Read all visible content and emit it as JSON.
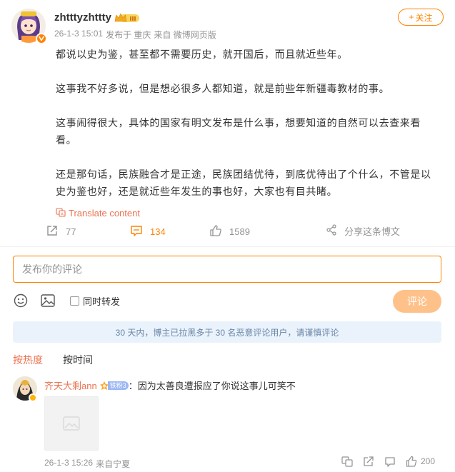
{
  "post": {
    "username": "zhtttyzhttty",
    "member_level": "III",
    "date": "26-1-3 15:01",
    "location": "发布于 重庆",
    "source": "来自 微博网页版",
    "follow_label": "关注",
    "paragraphs": [
      "都说以史为鉴，甚至都不需要历史，就开国后，而且就近些年。",
      "这事我不好多说，但是想必很多人都知道，就是前些年新疆毒教材的事。",
      "这事闹得很大，具体的国家有明文发布是什么事，想要知道的自然可以去查来看看。",
      "还是那句话，民族融合才是正途，民族团结优待，到底优待出了个什么，不管是以史为鉴也好，还是就近些年发生的事也好，大家也有目共睹。"
    ],
    "translate_label": "Translate content",
    "repost_count": "77",
    "comment_count": "134",
    "like_count": "1589",
    "share_label": "分享这条博文"
  },
  "composer": {
    "placeholder": "发布你的评论",
    "repost_label": "同时转发",
    "submit_label": "评论"
  },
  "notice": "30 天内，博主已拉黑多于 30 名恶意评论用户，请谨慎评论",
  "sort": {
    "hot_label": "按热度",
    "time_label": "按时间"
  },
  "comment": {
    "name": "齐天大剩ann",
    "fan_badge": "铁粉3",
    "text": "：因为太善良遭报应了你说这事儿可笑不",
    "date": "26-1-3 15:26",
    "location": "来自宁夏",
    "like_count": "200"
  },
  "colors": {
    "accent": "#ff8200",
    "link": "#eb7350",
    "notice_bg": "#eaf3fc",
    "submit_disabled": "#ffc18a"
  },
  "icons": [
    "repost-icon",
    "comment-icon",
    "like-icon",
    "share-icon",
    "emoji-icon",
    "image-icon",
    "translate-icon",
    "crown-icon",
    "verified-icon"
  ]
}
